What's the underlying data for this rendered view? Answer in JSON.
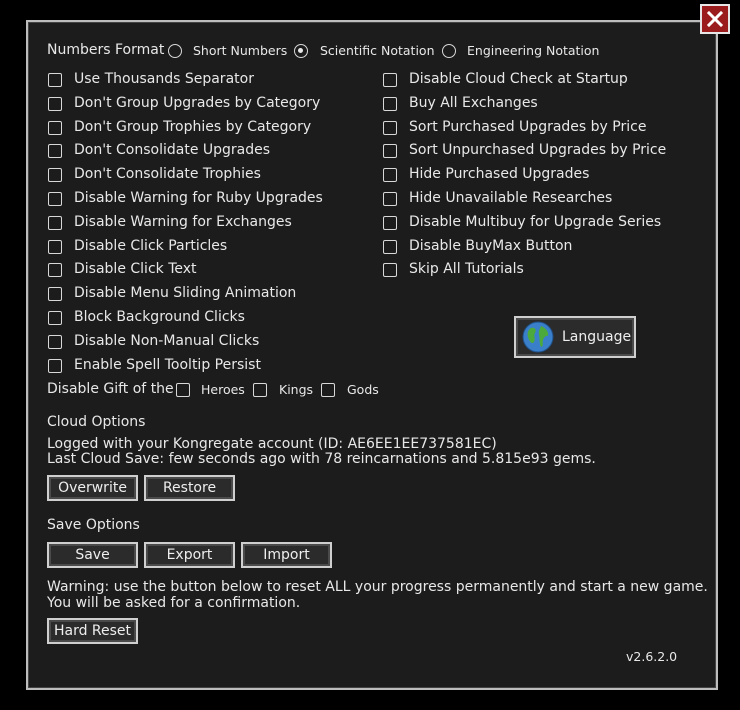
{
  "numbers_format": {
    "label": "Numbers Format",
    "options": [
      "Short Numbers",
      "Scientific Notation",
      "Engineering Notation"
    ],
    "selected": "Scientific Notation"
  },
  "left_options": [
    "Use Thousands Separator",
    "Don't Group Upgrades by Category",
    "Don't Group Trophies by Category",
    "Don't Consolidate Upgrades",
    "Don't Consolidate Trophies",
    "Disable Warning for Ruby Upgrades",
    "Disable Warning for Exchanges",
    "Disable Click Particles",
    "Disable Click Text",
    "Disable Menu Sliding Animation",
    "Block Background Clicks",
    "Disable Non-Manual Clicks",
    "Enable Spell Tooltip Persist"
  ],
  "right_options": [
    "Disable Cloud Check at Startup",
    "Buy All Exchanges",
    "Sort Purchased Upgrades by Price",
    "Sort Unpurchased Upgrades by Price",
    "Hide Purchased Upgrades",
    "Hide Unavailable Researches",
    "Disable Multibuy for Upgrade Series",
    "Disable BuyMax Button",
    "Skip All Tutorials"
  ],
  "gift": {
    "label": "Disable Gift of the",
    "options": [
      "Heroes",
      "Kings",
      "Gods"
    ]
  },
  "language_button": "Language",
  "cloud": {
    "title": "Cloud Options",
    "logged": "Logged with your Kongregate account (ID: AE6EE1EE737581EC)",
    "last_save": "Last Cloud Save: few seconds ago with 78 reincarnations and 5.815e93 gems.",
    "overwrite": "Overwrite",
    "restore": "Restore"
  },
  "save": {
    "title": "Save Options",
    "save": "Save",
    "export": "Export",
    "import": "Import"
  },
  "warning": {
    "line1": "Warning: use the button below to reset ALL your progress permanently and start a new game.",
    "line2": "You will be asked for a confirmation.",
    "hard_reset": "Hard Reset"
  },
  "version": "v2.6.2.0",
  "colors": {
    "close_bg": "#9b1c1c",
    "panel_bg": "#1c1c1c",
    "border": "#bdbdbd"
  }
}
